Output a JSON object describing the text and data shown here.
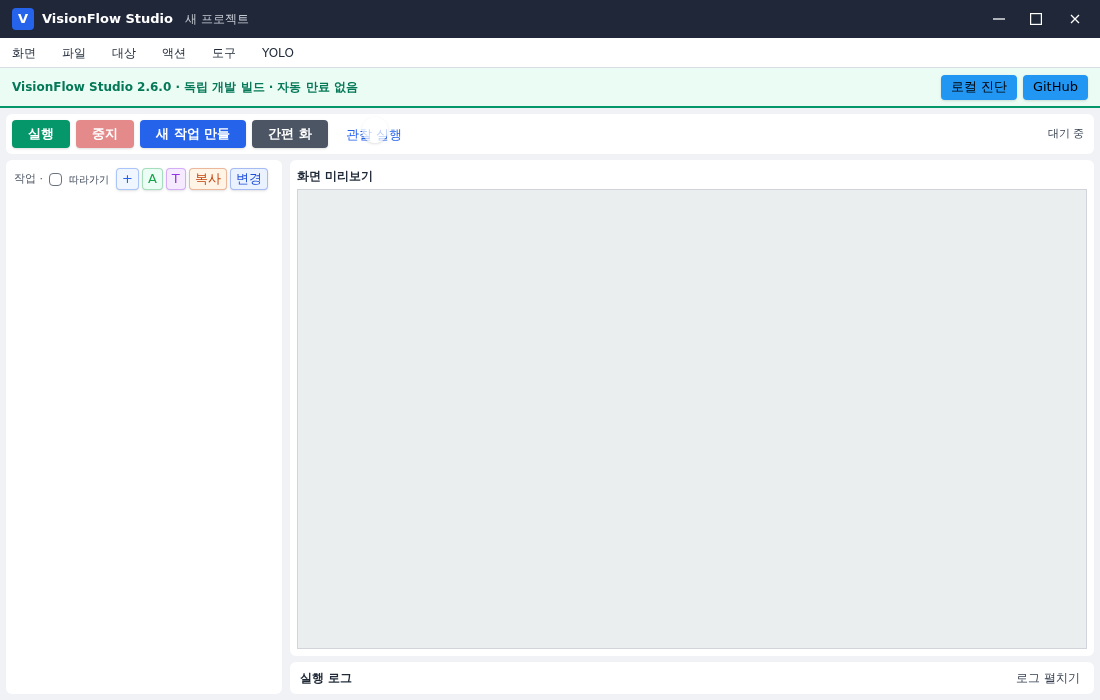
{
  "window": {
    "app_name": "VisionFlow Studio",
    "logo_letter": "V",
    "project": "새 프로젝트"
  },
  "menu": [
    "화면",
    "파일",
    "대상",
    "액션",
    "도구",
    "YOLO"
  ],
  "banner": {
    "text": "VisionFlow Studio 2.6.0 · 독립 개발 빌드 · 자동 만료 없음",
    "buttons": [
      "로컬 진단",
      "GitHub"
    ]
  },
  "toolbar": {
    "buttons": [
      {
        "label": "실행",
        "kind": "run",
        "disabled": false
      },
      {
        "label": "중지",
        "kind": "stop",
        "disabled": true
      },
      {
        "label": "새 작업 만들",
        "kind": "new",
        "disabled": false
      },
      {
        "label": "간편 화",
        "kind": "simple",
        "disabled": false
      }
    ],
    "link": "관찰 실행",
    "status": "대기 중"
  },
  "tasks": {
    "label": "작업 ·",
    "follow": {
      "label": "따라가기",
      "checked": false
    },
    "chips": [
      {
        "label": "+",
        "color": "#2563eb"
      },
      {
        "label": "A",
        "color": "#16a34a"
      },
      {
        "label": "T",
        "color": "#9333ea"
      },
      {
        "label": "복사",
        "color": "#c2410c"
      },
      {
        "label": "변경",
        "color": "#1d4ed8"
      }
    ]
  },
  "preview": {
    "title": "화면 미리보기"
  },
  "log": {
    "title": "실행 로그",
    "toggle": "로그 펼치기"
  }
}
